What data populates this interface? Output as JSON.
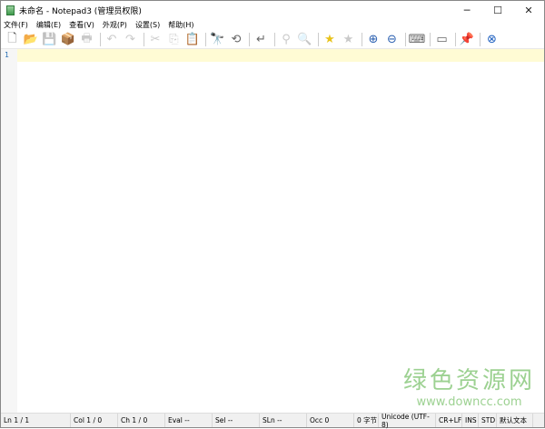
{
  "window": {
    "title": "未命名 - Notepad3 (管理员权限)",
    "minimize": "─",
    "maximize": "☐",
    "close": "✕"
  },
  "menu": [
    "文件(F)",
    "编辑(E)",
    "查看(V)",
    "外观(P)",
    "设置(S)",
    "帮助(H)"
  ],
  "toolbar": [
    {
      "icon": "new-file-icon",
      "glyph": "🗋",
      "enabled": true
    },
    {
      "icon": "open-folder-icon",
      "glyph": "📂",
      "enabled": true
    },
    {
      "icon": "save-icon",
      "glyph": "💾",
      "enabled": false
    },
    {
      "icon": "save-as-icon",
      "glyph": "📦",
      "enabled": true
    },
    {
      "icon": "print-icon",
      "glyph": "🖶",
      "enabled": false
    },
    {
      "sep": true
    },
    {
      "icon": "undo-icon",
      "glyph": "↶",
      "enabled": false
    },
    {
      "icon": "redo-icon",
      "glyph": "↷",
      "enabled": false
    },
    {
      "sep": true
    },
    {
      "icon": "cut-icon",
      "glyph": "✂",
      "enabled": false
    },
    {
      "icon": "copy-icon",
      "glyph": "⎘",
      "enabled": false
    },
    {
      "icon": "paste-icon",
      "glyph": "📋",
      "enabled": true
    },
    {
      "sep": true
    },
    {
      "icon": "find-icon",
      "glyph": "🔭",
      "enabled": true
    },
    {
      "icon": "replace-icon",
      "glyph": "⟲",
      "enabled": true
    },
    {
      "sep": true
    },
    {
      "icon": "word-wrap-icon",
      "glyph": "↵",
      "enabled": true
    },
    {
      "sep": true
    },
    {
      "icon": "fold-tree-icon",
      "glyph": "⚲",
      "enabled": false
    },
    {
      "icon": "goto-icon",
      "glyph": "🔍",
      "enabled": false
    },
    {
      "sep": true
    },
    {
      "icon": "favorite-star-icon",
      "glyph": "★",
      "enabled": true,
      "color": "#e8c21a"
    },
    {
      "icon": "add-favorite-icon",
      "glyph": "★",
      "enabled": false
    },
    {
      "sep": true
    },
    {
      "icon": "zoom-in-icon",
      "glyph": "⊕",
      "enabled": true,
      "color": "#2a5fb0"
    },
    {
      "icon": "zoom-out-icon",
      "glyph": "⊖",
      "enabled": true,
      "color": "#2a5fb0"
    },
    {
      "sep": true
    },
    {
      "icon": "keyboard-icon",
      "glyph": "⌨",
      "enabled": true
    },
    {
      "sep": true
    },
    {
      "icon": "console-icon",
      "glyph": "▭",
      "enabled": true
    },
    {
      "sep": true
    },
    {
      "icon": "pin-icon",
      "glyph": "📌",
      "enabled": true
    },
    {
      "sep": true
    },
    {
      "icon": "exit-icon",
      "glyph": "⊗",
      "enabled": true,
      "color": "#1d5fbf"
    }
  ],
  "editor": {
    "line_numbers": [
      "1"
    ],
    "current_line_color": "#fffbd4"
  },
  "watermark": {
    "name": "绿色资源网",
    "url": "www.downcc.com"
  },
  "status": [
    {
      "text": "Ln  1 / 1",
      "w": 77
    },
    {
      "text": "Col  1 / 0",
      "w": 52
    },
    {
      "text": "Ch  1 / 0",
      "w": 52
    },
    {
      "text": "Eval  --",
      "w": 52
    },
    {
      "text": "Sel  --",
      "w": 52
    },
    {
      "text": "SLn  --",
      "w": 52
    },
    {
      "text": "Occ  0",
      "w": 52
    },
    {
      "text": "0 字节",
      "w": 27
    },
    {
      "text": "Unicode (UTF-8)",
      "w": 63
    },
    {
      "text": "CR+LF",
      "w": 29
    },
    {
      "text": "INS",
      "w": 18
    },
    {
      "text": "STD",
      "w": 20
    },
    {
      "text": "默认文本",
      "w": 40
    }
  ]
}
